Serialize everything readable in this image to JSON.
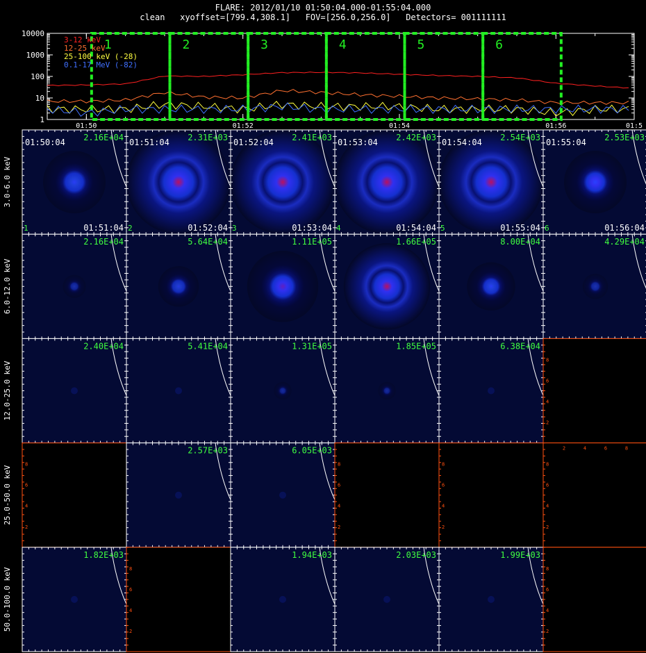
{
  "header": {
    "line1": "FLARE: 2012/01/10 01:50:04.000-01:55:04.000",
    "line2": "clean   xyoffset=[799.4,308.1]   FOV=[256.0,256.0]   Detectors= 001111111"
  },
  "light_curve": {
    "y_tick_labels": [
      "10000",
      "1000",
      "100",
      "10",
      "1"
    ],
    "x_tick_labels": [
      "01:50",
      "01:52",
      "01:54",
      "01:56",
      "01:5"
    ],
    "legend": [
      {
        "label": "3-12 keV",
        "color": "#ff2020"
      },
      {
        "label": "12-25 keV",
        "color": "#ff7030"
      },
      {
        "label": "25-100 keV (-28)",
        "color": "#ffff40"
      },
      {
        "label": "0.1-17 MeV (-82)",
        "color": "#4070ff"
      }
    ],
    "interval_labels": [
      "1",
      "2",
      "3",
      "4",
      "5",
      "6"
    ],
    "interval_color": "#22ee22"
  },
  "grid": {
    "energy_labels": [
      "3.0-6.0 keV",
      "6.0-12.0 keV",
      "12.0-25.0 keV",
      "25.0-50.0 keV",
      "50.0-100.0 keV"
    ],
    "start_times": [
      "01:50:04",
      "01:51:04",
      "01:52:04",
      "01:53:04",
      "01:54:04",
      "01:55:04"
    ],
    "end_times": [
      "01:51:04",
      "01:52:04",
      "01:53:04",
      "01:54:04",
      "01:55:04",
      "01:56:04"
    ],
    "interval_numbers": [
      "1",
      "2",
      "3",
      "4",
      "5",
      "6"
    ],
    "maxima": [
      [
        "2.16E+04",
        "2.31E+03",
        "2.41E+03",
        "2.42E+03",
        "2.54E+03",
        "2.53E+03"
      ],
      [
        "2.16E+04",
        "5.64E+04",
        "1.11E+05",
        "1.66E+05",
        "8.00E+04",
        "4.29E+04"
      ],
      [
        "2.40E+04",
        "5.41E+04",
        "1.31E+05",
        "1.85E+05",
        "6.38E+04",
        ""
      ],
      [
        "",
        "2.57E+03",
        "6.05E+03",
        "",
        "",
        ""
      ],
      [
        "1.82E+03",
        "",
        "1.94E+03",
        "2.03E+03",
        "1.99E+03",
        ""
      ]
    ],
    "empty_axis_ticks": [
      "2",
      "4",
      "6",
      "8"
    ],
    "maxima_color": "#40ff40",
    "empty_axis_color": "#ff5010"
  },
  "chart_data": [
    {
      "type": "line",
      "scale": "log",
      "ylim": [
        1,
        10000
      ],
      "x_labels": [
        "01:50",
        "01:52",
        "01:54",
        "01:56"
      ],
      "series": [
        {
          "name": "3-12 keV",
          "x": [
            "01:49:30",
            "01:50:00",
            "01:50:30",
            "01:51:00",
            "01:51:30",
            "01:52:00",
            "01:52:30",
            "01:53:00",
            "01:53:30",
            "01:54:00",
            "01:54:30",
            "01:55:00",
            "01:55:30",
            "01:56:00",
            "01:56:30",
            "01:57:00"
          ],
          "values": [
            38,
            40,
            45,
            105,
            100,
            120,
            150,
            155,
            145,
            125,
            110,
            100,
            85,
            48,
            36,
            28
          ]
        },
        {
          "name": "12-25 keV",
          "x": [
            "01:49:30",
            "01:50:00",
            "01:50:30",
            "01:51:00",
            "01:51:30",
            "01:52:00",
            "01:52:30",
            "01:53:00",
            "01:53:30",
            "01:54:00",
            "01:54:30",
            "01:55:00",
            "01:55:30",
            "01:56:00",
            "01:56:30",
            "01:57:00"
          ],
          "values": [
            7,
            7,
            8,
            18,
            11,
            10,
            22,
            18,
            14,
            12,
            10,
            9,
            8,
            6,
            6,
            6
          ]
        },
        {
          "name": "25-100 keV (-28)",
          "x": [
            "01:49:30",
            "01:50:00",
            "01:50:30",
            "01:51:00",
            "01:51:30",
            "01:52:00",
            "01:52:30",
            "01:53:00",
            "01:53:30",
            "01:54:00",
            "01:54:30",
            "01:55:00",
            "01:55:30",
            "01:56:00",
            "01:56:30",
            "01:57:00"
          ],
          "values": [
            3,
            3,
            3,
            5,
            4,
            3,
            5,
            4,
            4,
            4,
            3,
            3,
            3,
            2,
            3,
            3
          ]
        },
        {
          "name": "0.1-17 MeV (-82)",
          "x": [
            "01:49:30",
            "01:50:00",
            "01:50:30",
            "01:51:00",
            "01:51:30",
            "01:52:00",
            "01:52:30",
            "01:53:00",
            "01:53:30",
            "01:54:00",
            "01:54:30",
            "01:55:00",
            "01:55:30",
            "01:56:00",
            "01:56:30",
            "01:57:00"
          ],
          "values": [
            3,
            2,
            3,
            3,
            3,
            3,
            4,
            3,
            3,
            3,
            3,
            3,
            3,
            3,
            3,
            3
          ]
        }
      ],
      "intervals": [
        [
          "01:50:04",
          "01:51:04"
        ],
        [
          "01:51:04",
          "01:52:04"
        ],
        [
          "01:52:04",
          "01:53:04"
        ],
        [
          "01:53:04",
          "01:54:04"
        ],
        [
          "01:54:04",
          "01:55:04"
        ],
        [
          "01:55:04",
          "01:56:04"
        ]
      ]
    },
    {
      "type": "heatmap",
      "rows": [
        "3.0-6.0 keV",
        "6.0-12.0 keV",
        "12.0-25.0 keV",
        "25.0-50.0 keV",
        "50.0-100.0 keV"
      ],
      "columns": [
        "01:50:04",
        "01:51:04",
        "01:52:04",
        "01:53:04",
        "01:54:04",
        "01:55:04"
      ],
      "maxima": [
        [
          21600,
          2310,
          2410,
          2420,
          2540,
          2530
        ],
        [
          21600,
          56400,
          111000,
          166000,
          80000,
          42900
        ],
        [
          24000,
          54100,
          131000,
          185000,
          63800,
          null
        ],
        [
          null,
          2570,
          6050,
          null,
          null,
          null
        ],
        [
          1820,
          null,
          1940,
          2030,
          1990,
          null
        ]
      ],
      "source_intensity": [
        [
          0.45,
          0.9,
          1.0,
          1.0,
          0.9,
          0.55
        ],
        [
          0.12,
          0.35,
          0.75,
          0.95,
          0.45,
          0.15
        ],
        [
          0.0,
          0.0,
          0.05,
          0.05,
          0.0,
          null
        ],
        [
          null,
          0.0,
          0.0,
          null,
          null,
          null
        ],
        [
          0.0,
          null,
          0.0,
          0.0,
          0.0,
          null
        ]
      ]
    }
  ]
}
